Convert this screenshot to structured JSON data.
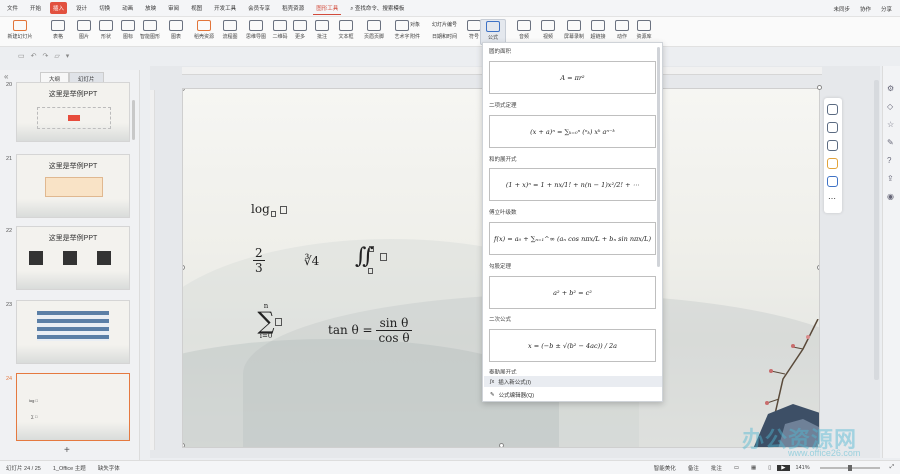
{
  "menubar": {
    "file": "文件",
    "start": "开始",
    "insert": "插入",
    "design": "设计",
    "switch": "切换",
    "animation": "动画",
    "slideshow": "放映",
    "review": "审阅",
    "view": "视图",
    "devtools": "开发工具",
    "member": "会员专享",
    "daoke": "稻壳资源",
    "ctx_tab": "图形工具",
    "search": "查找命令、搜索模板",
    "unsynced": "未同步",
    "collab": "协作",
    "share": "分享"
  },
  "toolbar": {
    "new_slide": "新建幻灯片",
    "table": "表格",
    "image": "图片",
    "shape": "形状",
    "icon": "图标",
    "smart": "智能图形",
    "chart": "图表",
    "daoke_res": "稻壳资源",
    "flowchart": "流程图",
    "mindmap": "思维导图",
    "qrcode": "二维码",
    "more": "更多",
    "annotation": "批注",
    "textbox": "文本框",
    "header_footer": "页眉页脚",
    "wordart": "艺术字",
    "object": "对象",
    "attachment": "附件",
    "slide_number": "幻灯片编号",
    "datetime": "日期和时间",
    "symbol": "符号",
    "formula": "公式",
    "audio": "音频",
    "video": "视频",
    "screen_rec": "屏幕录制",
    "hyperlink": "超链接",
    "action": "动作",
    "camera": "资源库"
  },
  "leftpanel": {
    "tab_outline": "大纲",
    "tab_slides": "幻灯片",
    "add": "+",
    "slides": [
      {
        "num": "20",
        "title": "这里是举例PPT"
      },
      {
        "num": "21",
        "title": "这里是举例PPT"
      },
      {
        "num": "22",
        "title": "这里是举例PPT"
      },
      {
        "num": "23",
        "title": ""
      },
      {
        "num": "24",
        "title": ""
      }
    ]
  },
  "slide": {
    "log": "log",
    "frac_n": "2",
    "frac_d": "3",
    "root": "∛4",
    "integral": "∬",
    "sum": "∑",
    "sum_top": "n",
    "sum_bot": "i=0",
    "tan": "tan θ =",
    "tan_n": "sin θ",
    "tan_d": "cos θ"
  },
  "formula_menu": {
    "sections": [
      {
        "label": "圆的面积",
        "formula": "A = πr²"
      },
      {
        "label": "二项式定理",
        "formula": "(x + a)ⁿ = ∑ₖ₌₀ⁿ (ⁿₖ) xᵏ aⁿ⁻ᵏ"
      },
      {
        "label": "和的展开式",
        "formula": "(1 + x)ⁿ = 1 + nx/1! + n(n − 1)x²/2! + ⋯"
      },
      {
        "label": "傅立叶级数",
        "formula": "f(x) = a₀ + ∑ₙ₌₁^∞ (aₙ cos nπx/L + bₙ sin nπx/L)"
      },
      {
        "label": "勾股定理",
        "formula": "a² + b² = c²"
      },
      {
        "label": "二次公式",
        "formula": "x = (−b ± √(b² − 4ac)) / 2a"
      },
      {
        "label": "泰勒展开式",
        "formula": ""
      }
    ],
    "insert_new": "插入新公式(I)",
    "editor": "公式编辑器(Q)"
  },
  "statusbar": {
    "slide_pos": "幻灯片 24 / 25",
    "theme": "1_Office 主题",
    "missing_font": "缺失字体",
    "smart_beautify": "智能美化",
    "notes": "备注",
    "comment": "批注",
    "zoom": "141%"
  },
  "watermark": {
    "main": "办公资源网",
    "url": "www.office26.com"
  }
}
